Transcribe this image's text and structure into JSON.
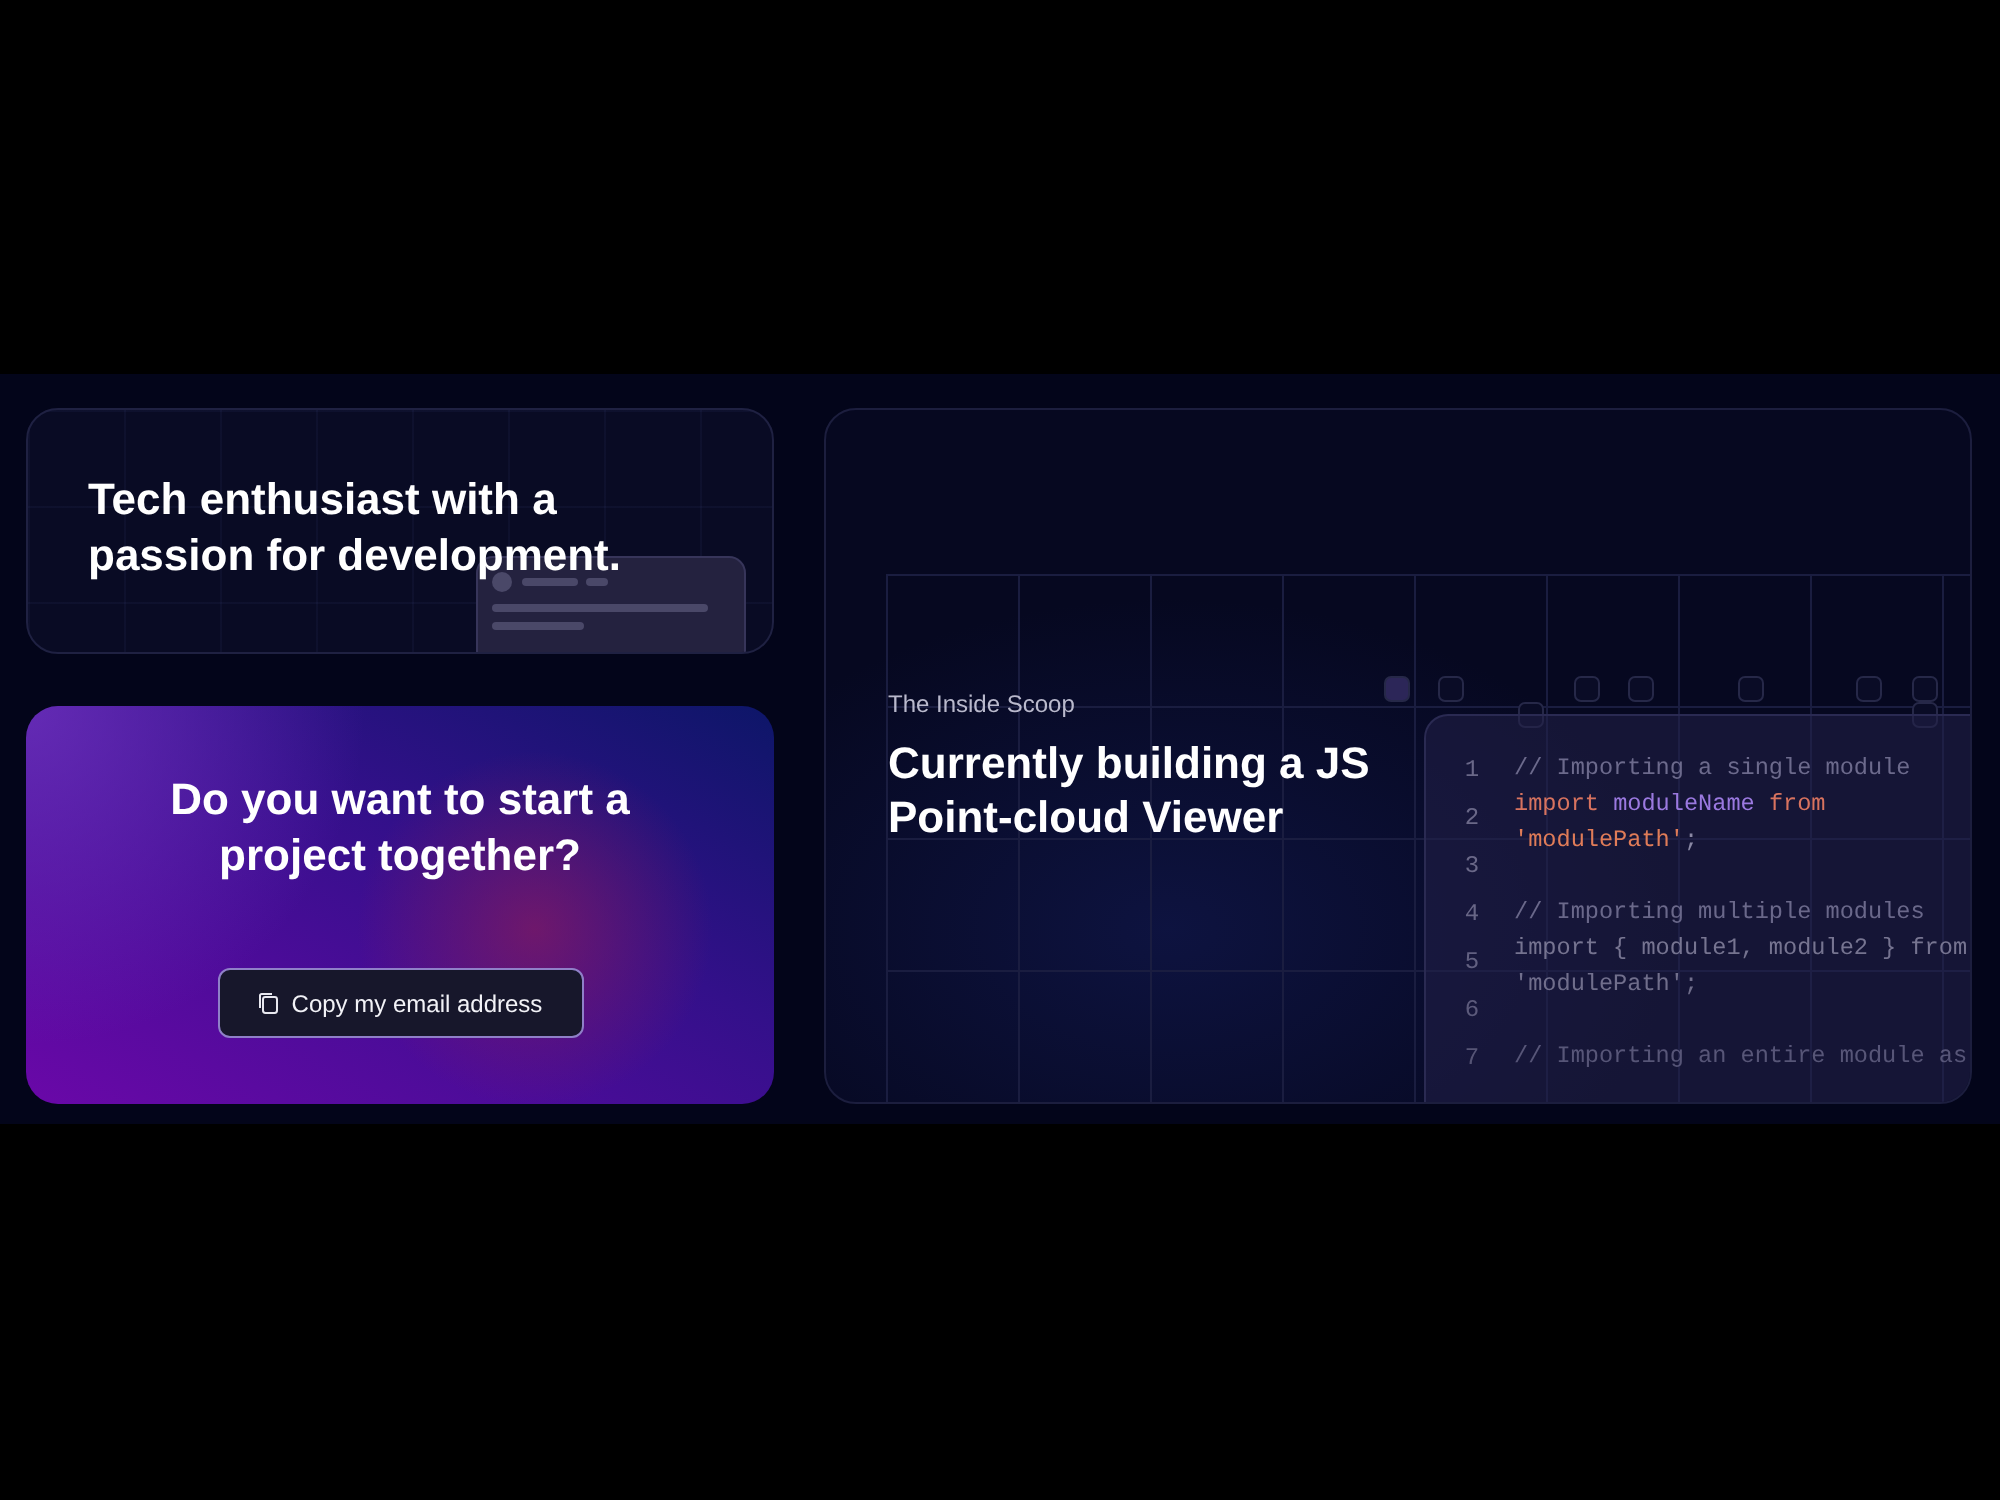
{
  "intro_card": {
    "heading": "Tech enthusiast with a passion for development."
  },
  "contact_card": {
    "heading": "Do you want to start a project together?",
    "button": {
      "label": "Copy my email address"
    }
  },
  "project_card": {
    "eyebrow": "The Inside Scoop",
    "heading": "Currently building a JS Point-cloud Viewer",
    "code": {
      "line_numbers": [
        "1",
        "2",
        "3",
        "4",
        "5",
        "6",
        "7"
      ],
      "lines": [
        {
          "kind": "code",
          "tokens": [
            {
              "kind": "comment",
              "text": "// Importing a single module"
            }
          ]
        },
        {
          "kind": "code",
          "tokens": [
            {
              "kind": "keyword",
              "text": "import "
            },
            {
              "kind": "identifier",
              "text": "moduleName "
            },
            {
              "kind": "keyword",
              "text": "from"
            }
          ]
        },
        {
          "kind": "code",
          "tokens": [
            {
              "kind": "string",
              "text": "'modulePath'"
            },
            {
              "kind": "punct",
              "text": ";"
            }
          ]
        },
        {
          "kind": "blank"
        },
        {
          "kind": "code",
          "tokens": [
            {
              "kind": "comment",
              "text": "// Importing multiple modules"
            }
          ]
        },
        {
          "kind": "code",
          "tokens": [
            {
              "kind": "plain",
              "text": "import { module1, module2 } from"
            }
          ]
        },
        {
          "kind": "code",
          "tokens": [
            {
              "kind": "plain",
              "text": "'modulePath';"
            }
          ]
        },
        {
          "kind": "blank"
        },
        {
          "kind": "code",
          "tokens": [
            {
              "kind": "comment",
              "text": "// Importing an entire module as"
            }
          ]
        }
      ]
    }
  }
}
